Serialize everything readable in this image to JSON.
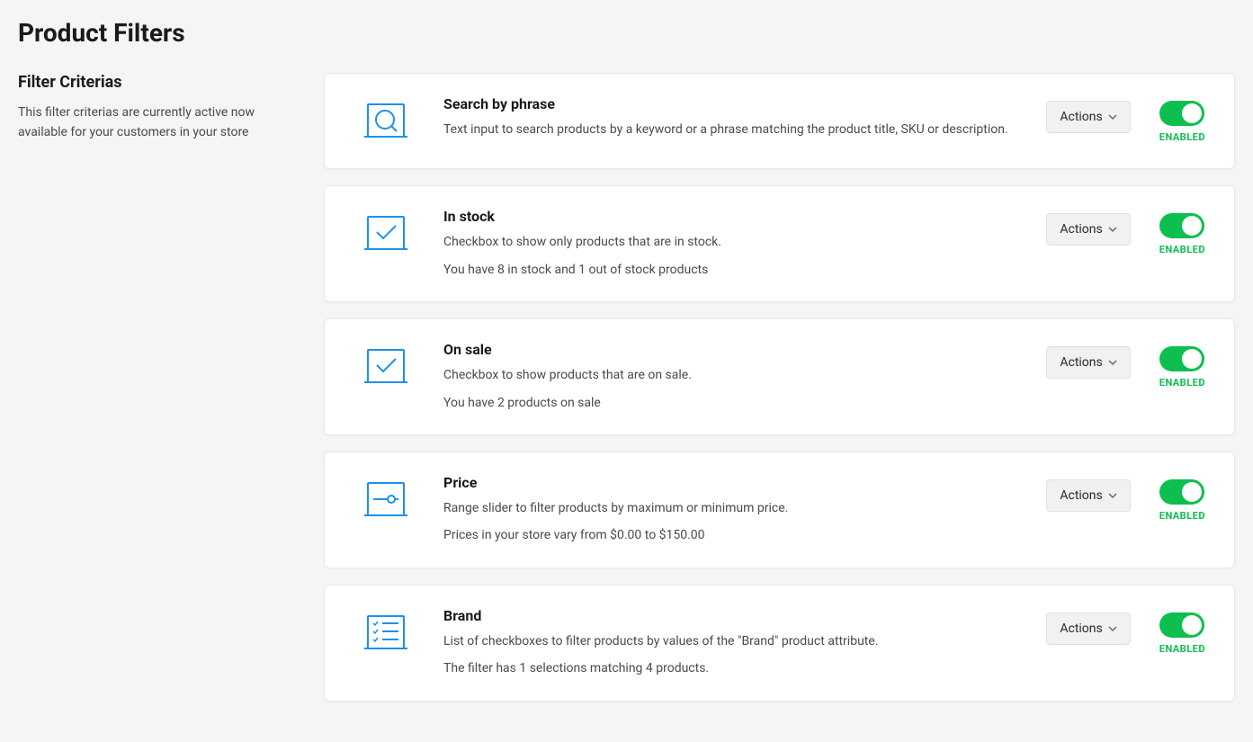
{
  "page": {
    "title": "Product Filters"
  },
  "sidebar": {
    "title": "Filter Criterias",
    "description": "This filter criterias are currently active now available for your customers in your store"
  },
  "actionsLabel": "Actions",
  "enabledLabel": "ENABLED",
  "filters": [
    {
      "title": "Search by phrase",
      "description": "Text input to search products by a keyword or a phrase matching the product title, SKU or description.",
      "meta": "",
      "icon": "search",
      "enabled": true
    },
    {
      "title": "In stock",
      "description": "Checkbox to show only products that are in stock.",
      "meta": "You have 8 in stock and 1 out of stock products",
      "icon": "check",
      "enabled": true
    },
    {
      "title": "On sale",
      "description": "Checkbox to show products that are on sale.",
      "meta": "You have 2 products on sale",
      "icon": "check",
      "enabled": true
    },
    {
      "title": "Price",
      "description": "Range slider to filter products by maximum or minimum price.",
      "meta": "Prices in your store vary from $0.00 to $150.00",
      "icon": "slider",
      "enabled": true
    },
    {
      "title": "Brand",
      "description": "List of checkboxes to filter products by values of the \"Brand\" product attribute.",
      "meta": "The filter has 1 selections matching 4 products.",
      "icon": "list",
      "enabled": true
    }
  ]
}
